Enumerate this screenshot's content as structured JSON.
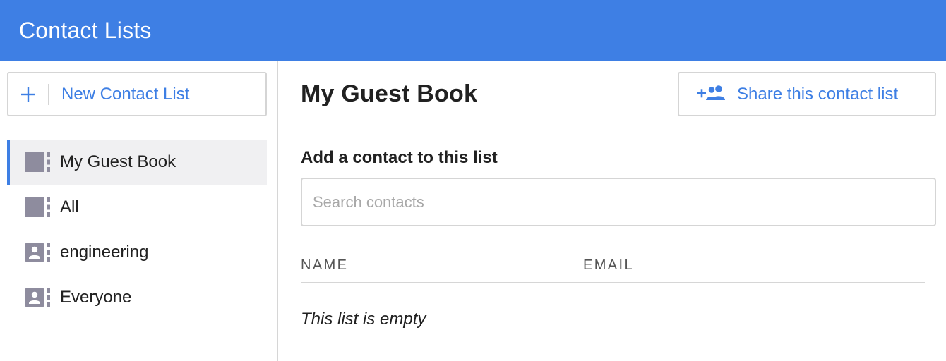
{
  "header": {
    "title": "Contact Lists"
  },
  "sidebar": {
    "new_list_label": "New Contact List",
    "items": [
      {
        "label": "My Guest Book",
        "icon": "book-icon",
        "active": true
      },
      {
        "label": "All",
        "icon": "book-icon",
        "active": false
      },
      {
        "label": "engineering",
        "icon": "contact-card-icon",
        "active": false
      },
      {
        "label": "Everyone",
        "icon": "contact-card-icon",
        "active": false
      }
    ]
  },
  "main": {
    "title": "My Guest Book",
    "share_label": "Share this contact list",
    "add_contact_label": "Add a contact to this list",
    "search_placeholder": "Search contacts",
    "table": {
      "columns": [
        "NAME",
        "EMAIL"
      ],
      "rows": []
    },
    "empty_message": "This list is empty"
  },
  "colors": {
    "accent": "#3e7fe4",
    "icon_gray": "#8e8c9e",
    "active_bg": "#f0f0f2"
  }
}
